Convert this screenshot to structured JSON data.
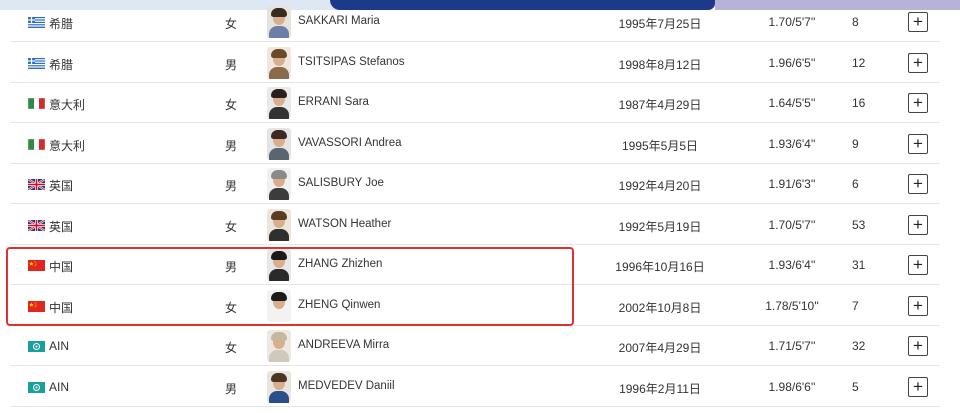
{
  "header_colors": {
    "light": "#dde8f4",
    "navy": "#1d3a8a",
    "lavender": "#b7b3d8"
  },
  "highlight_color": "#e0322c",
  "rows": [
    {
      "flag": "greece",
      "country": "希腊",
      "gender": "女",
      "name": "SAKKARI Maria",
      "dob": "1995年7月25日",
      "height": "1.70/5'7''",
      "ranking": "8"
    },
    {
      "flag": "greece",
      "country": "希腊",
      "gender": "男",
      "name": "TSITSIPAS Stefanos",
      "dob": "1998年8月12日",
      "height": "1.96/6'5''",
      "ranking": "12"
    },
    {
      "flag": "italy",
      "country": "意大利",
      "gender": "女",
      "name": "ERRANI Sara",
      "dob": "1987年4月29日",
      "height": "1.64/5'5''",
      "ranking": "16"
    },
    {
      "flag": "italy",
      "country": "意大利",
      "gender": "男",
      "name": "VAVASSORI Andrea",
      "dob": "1995年5月5日",
      "height": "1.93/6'4''",
      "ranking": "9"
    },
    {
      "flag": "uk",
      "country": "英国",
      "gender": "男",
      "name": "SALISBURY Joe",
      "dob": "1992年4月20日",
      "height": "1.91/6'3''",
      "ranking": "6"
    },
    {
      "flag": "uk",
      "country": "英国",
      "gender": "女",
      "name": "WATSON Heather",
      "dob": "1992年5月19日",
      "height": "1.70/5'7''",
      "ranking": "53"
    },
    {
      "flag": "china",
      "country": "中国",
      "gender": "男",
      "name": "ZHANG Zhizhen",
      "dob": "1996年10月16日",
      "height": "1.93/6'4''",
      "ranking": "31"
    },
    {
      "flag": "china",
      "country": "中国",
      "gender": "女",
      "name": "ZHENG Qinwen",
      "dob": "2002年10月8日",
      "height": "1.78/5'10''",
      "ranking": "7"
    },
    {
      "flag": "ain",
      "country": "AIN",
      "gender": "女",
      "name": "ANDREEVA Mirra",
      "dob": "2007年4月29日",
      "height": "1.71/5'7''",
      "ranking": "32"
    },
    {
      "flag": "ain",
      "country": "AIN",
      "gender": "男",
      "name": "MEDVEDEV Daniil",
      "dob": "1996年2月11日",
      "height": "1.98/6'6''",
      "ranking": "5"
    }
  ],
  "expand_label": "+"
}
